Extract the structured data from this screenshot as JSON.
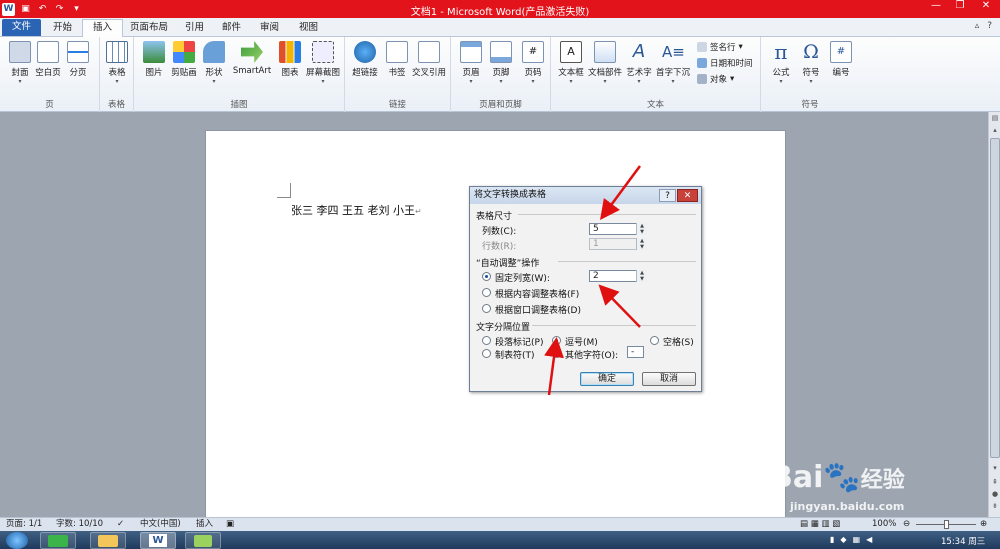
{
  "app": {
    "title": "文档1 - Microsoft Word(产品激活失败)",
    "quick_access": [
      "save-icon",
      "undo-icon",
      "redo-icon"
    ]
  },
  "tabs": [
    {
      "label": "文件"
    },
    {
      "label": "开始"
    },
    {
      "label": "插入"
    },
    {
      "label": "页面布局"
    },
    {
      "label": "引用"
    },
    {
      "label": "邮件"
    },
    {
      "label": "审阅"
    },
    {
      "label": "视图"
    }
  ],
  "ribbon": {
    "groups": {
      "pages": "页",
      "tables": "表格",
      "illustrations": "插图",
      "links": "链接",
      "header_footer": "页眉和页脚",
      "text": "文本",
      "symbols": "符号"
    },
    "buttons": {
      "cover": "封面",
      "blank_page": "空白页",
      "page_break": "分页",
      "table": "表格",
      "picture": "图片",
      "clipart": "剪贴画",
      "shapes": "形状",
      "smartart": "SmartArt",
      "chart": "图表",
      "screenshot": "屏幕截图",
      "hyperlink": "超链接",
      "bookmark": "书签",
      "cross_ref": "交叉引用",
      "header": "页眉",
      "footer": "页脚",
      "page_number": "页码",
      "textbox": "文本框",
      "quickparts": "文档部件",
      "wordart": "艺术字",
      "dropcap": "首字下沉",
      "signature": "签名行",
      "datetime": "日期和时间",
      "object": "对象",
      "equation": "公式",
      "symbol": "符号",
      "number": "编号"
    },
    "equation_glyph": "π",
    "symbol_glyph": "Ω"
  },
  "document": {
    "text": "张三 李四 王五  老刘 小王"
  },
  "dialog": {
    "title": "将文字转换成表格",
    "help": "?",
    "close": "✕",
    "table_size": "表格尺寸",
    "columns_label": "列数(C):",
    "columns_value": "5",
    "rows_label": "行数(R):",
    "rows_value": "1",
    "autofit_section": "“自动调整”操作",
    "fixed_width_label": "固定列宽(W):",
    "fixed_width_value": "2",
    "autofit_content": "根据内容调整表格(F)",
    "autofit_window": "根据窗口调整表格(D)",
    "separator_section": "文字分隔位置",
    "sep_paragraph": "段落标记(P)",
    "sep_comma": "逗号(M)",
    "sep_space": "空格(S)",
    "sep_tab": "制表符(T)",
    "sep_other": "其他字符(O):",
    "sep_other_value": "-",
    "ok": "确定",
    "cancel": "取消",
    "selected_autofit": "fixed_width",
    "selected_separator": "comma"
  },
  "status": {
    "page": "页面: 1/1",
    "words": "字数: 10/10",
    "language": "中文(中国)",
    "insert": "插入",
    "zoom": "100%",
    "zoom_level": 1.0
  },
  "taskbar": {
    "time": "15:34 周三"
  },
  "watermark": {
    "brand": "Bai",
    "brand2": "经验",
    "url": "jingyan.baidu.com"
  },
  "colors": {
    "title_bar": "#e3131b",
    "file_tab": "#2b63b5",
    "arrow": "#e01010"
  }
}
